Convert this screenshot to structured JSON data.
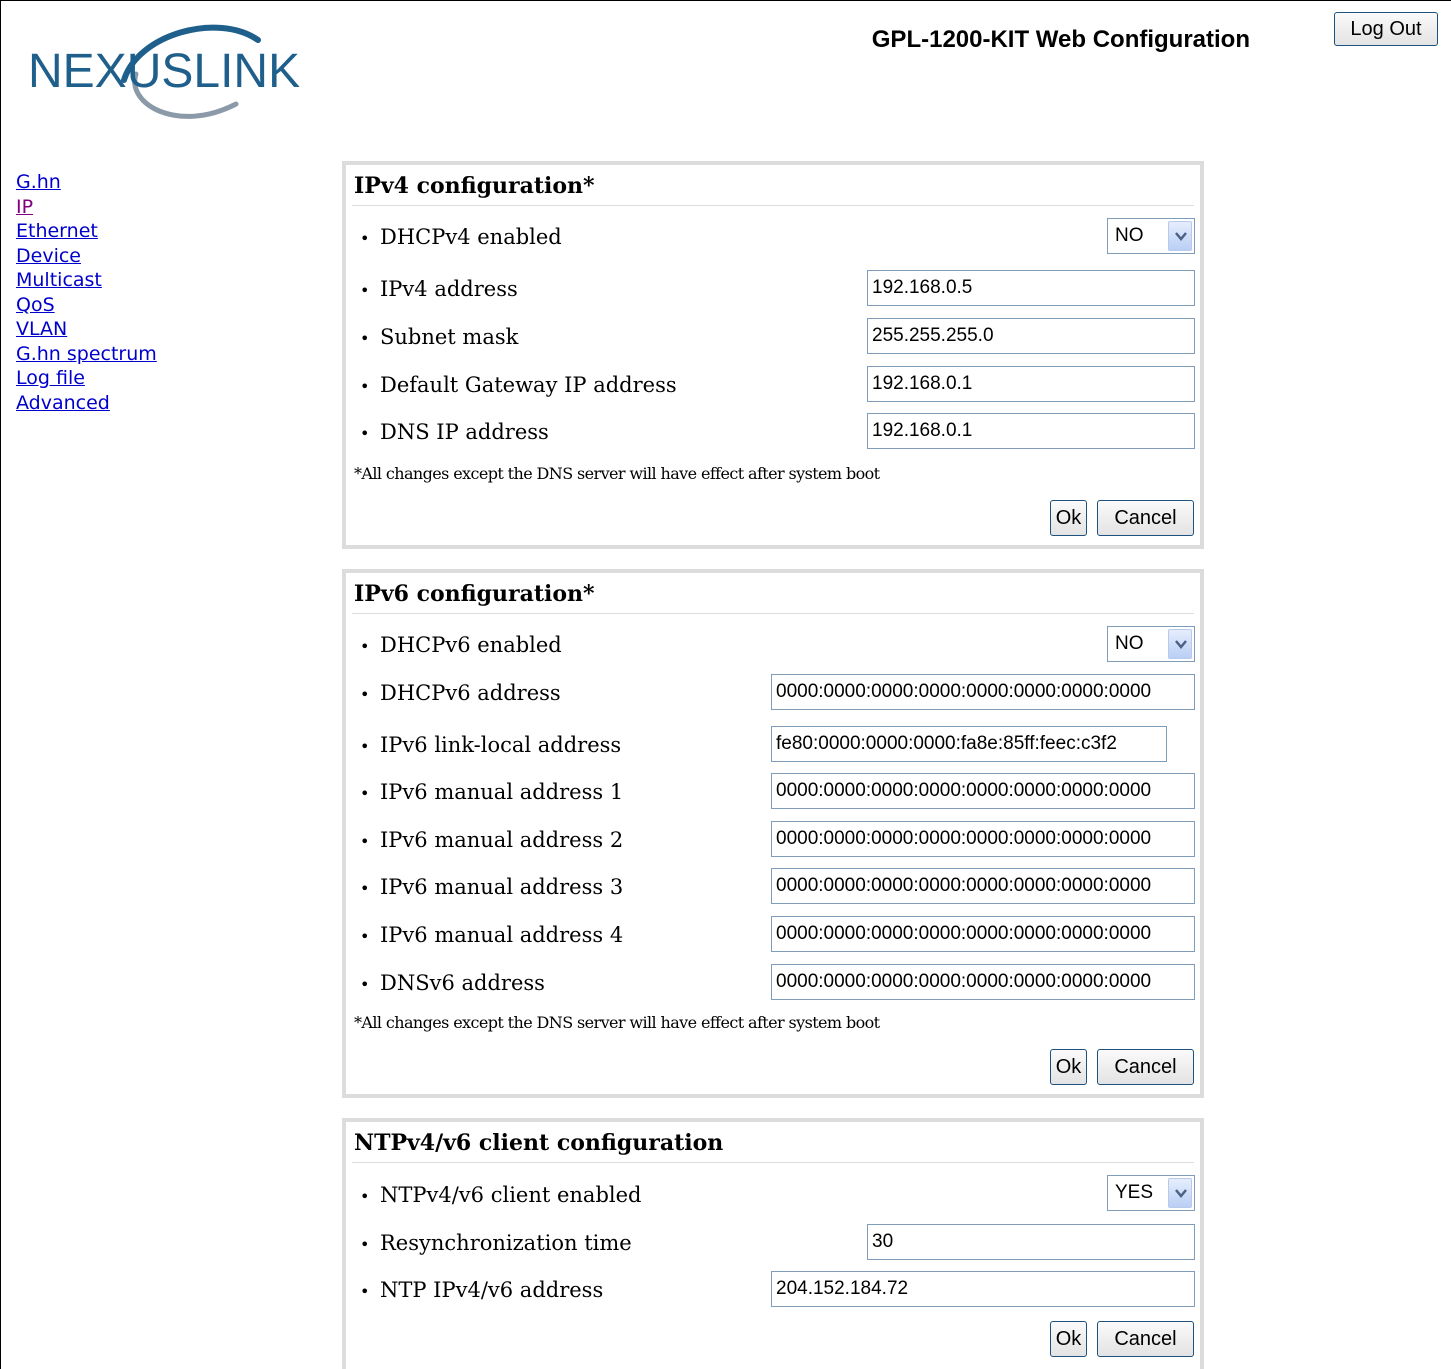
{
  "header": {
    "app_title": "GPL-1200-KIT Web Configuration",
    "logo_text": "NEXUSLINK",
    "logout_label": "Log Out"
  },
  "sidebar": {
    "items": [
      {
        "label": "G.hn"
      },
      {
        "label": "IP"
      },
      {
        "label": "Ethernet"
      },
      {
        "label": "Device"
      },
      {
        "label": "Multicast"
      },
      {
        "label": "QoS"
      },
      {
        "label": "VLAN"
      },
      {
        "label": "G.hn spectrum"
      },
      {
        "label": "Log file"
      },
      {
        "label": "Advanced"
      }
    ]
  },
  "ipv4": {
    "title": "IPv4 configuration*",
    "dhcp_label": "DHCPv4 enabled",
    "dhcp_value": "NO",
    "address_label": "IPv4 address",
    "address_value": "192.168.0.5",
    "subnet_label": "Subnet mask",
    "subnet_value": "255.255.255.0",
    "gateway_label": "Default Gateway IP address",
    "gateway_value": "192.168.0.1",
    "dns_label": "DNS IP address",
    "dns_value": "192.168.0.1",
    "note": "*All changes except the DNS server will have effect after system boot",
    "ok_label": "Ok",
    "cancel_label": "Cancel"
  },
  "ipv6": {
    "title": "IPv6 configuration*",
    "dhcp_label": "DHCPv6 enabled",
    "dhcp_value": "NO",
    "dhcp_address_label": "DHCPv6 address",
    "dhcp_address_value": "0000:0000:0000:0000:0000:0000:0000:0000",
    "link_local_label": "IPv6 link-local address",
    "link_local_value": "fe80:0000:0000:0000:fa8e:85ff:feec:c3f2",
    "manual1_label": "IPv6 manual address 1",
    "manual1_value": "0000:0000:0000:0000:0000:0000:0000:0000",
    "manual2_label": "IPv6 manual address 2",
    "manual2_value": "0000:0000:0000:0000:0000:0000:0000:0000",
    "manual3_label": "IPv6 manual address 3",
    "manual3_value": "0000:0000:0000:0000:0000:0000:0000:0000",
    "manual4_label": "IPv6 manual address 4",
    "manual4_value": "0000:0000:0000:0000:0000:0000:0000:0000",
    "dns_label": "DNSv6 address",
    "dns_value": "0000:0000:0000:0000:0000:0000:0000:0000",
    "note": "*All changes except the DNS server will have effect after system boot",
    "ok_label": "Ok",
    "cancel_label": "Cancel"
  },
  "ntp": {
    "title": "NTPv4/v6 client configuration",
    "enabled_label": "NTPv4/v6 client enabled",
    "enabled_value": "YES",
    "resync_label": "Resynchronization time",
    "resync_value": "30",
    "address_label": "NTP IPv4/v6 address",
    "address_value": "204.152.184.72",
    "ok_label": "Ok",
    "cancel_label": "Cancel"
  },
  "colors": {
    "logo": "#1f5f8b",
    "link": "#0000cc",
    "visited_link": "#800080",
    "panel_border": "#dcdcdc",
    "field_border": "#7f9db9"
  }
}
